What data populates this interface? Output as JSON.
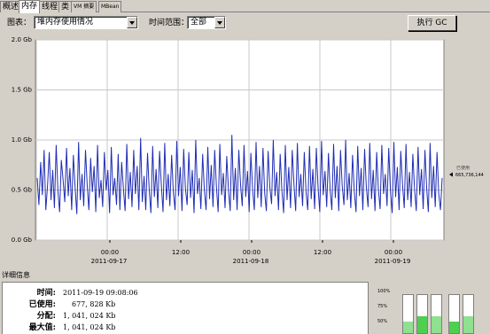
{
  "tabs": [
    {
      "label": "概述",
      "active": false
    },
    {
      "label": "内存",
      "active": true
    },
    {
      "label": "线程",
      "active": false
    },
    {
      "label": "类",
      "active": false
    },
    {
      "label": "VM 摘要",
      "active": false
    },
    {
      "label": "MBean",
      "active": false
    }
  ],
  "toolbar": {
    "chart_label": "图表：",
    "chart_value": "堆内存使用情况",
    "time_label": "时间范围：",
    "time_value": "全部",
    "gc_button": "执行 GC"
  },
  "chart_data": {
    "type": "line",
    "y_ticks": [
      "2.0 Gb",
      "1.5 Gb",
      "1.0 Gb",
      "0.5 Gb",
      "0.0 Gb"
    ],
    "ylim": [
      0,
      2.0
    ],
    "x_ticks": [
      {
        "time": "00:00",
        "date": "2011-09-17"
      },
      {
        "time": "12:00",
        "date": ""
      },
      {
        "time": "00:00",
        "date": "2011-09-18"
      },
      {
        "time": "12:00",
        "date": ""
      },
      {
        "time": "00:00",
        "date": "2011-09-19"
      }
    ],
    "legend_label": "已使用",
    "legend_value": "665,736,144",
    "series_color": "#1f2db4",
    "series": [
      {
        "values": [
          0.62,
          0.35,
          0.78,
          0.45,
          0.9,
          0.3,
          0.55,
          0.88,
          0.4,
          0.7,
          0.32,
          0.95,
          0.5,
          0.28,
          0.8,
          0.6,
          0.38,
          0.92,
          0.44,
          0.72,
          0.3,
          0.85,
          0.52,
          0.26,
          0.98,
          0.4,
          0.66,
          0.34,
          0.9,
          0.55,
          0.3,
          0.82,
          0.48,
          0.74,
          0.28,
          0.95,
          0.42,
          0.6,
          0.33,
          0.88,
          0.5,
          0.7,
          0.27,
          0.93,
          0.45,
          0.62,
          0.35,
          0.86,
          0.3,
          0.78,
          0.52,
          0.29,
          0.96,
          0.41,
          0.68,
          0.33,
          0.9,
          0.46,
          0.74,
          0.3,
          1.02,
          0.38,
          0.64,
          0.3,
          0.87,
          0.5,
          0.27,
          0.94,
          0.43,
          0.71,
          0.32,
          0.89,
          0.56,
          0.28,
          0.97,
          0.4,
          0.66,
          0.34,
          0.85,
          0.48,
          0.3,
          0.99,
          0.44,
          0.73,
          0.29,
          0.91,
          0.52,
          0.35,
          0.88,
          0.42,
          0.7,
          0.27,
          1.0,
          0.46,
          0.62,
          0.31,
          0.86,
          0.5,
          0.3,
          0.93,
          0.41,
          0.75,
          0.33,
          0.9,
          0.54,
          0.28,
          0.96,
          0.45,
          0.67,
          0.32,
          0.84,
          0.49,
          0.29,
          1.05,
          0.4,
          0.72,
          0.3,
          0.9,
          0.55,
          0.34,
          0.95,
          0.43,
          0.69,
          0.28,
          0.87,
          0.51,
          0.3,
          0.98,
          0.42,
          0.74,
          0.33,
          0.92,
          0.47,
          0.29,
          0.89,
          0.53,
          0.36,
          1.0,
          0.44,
          0.68,
          0.3,
          0.86,
          0.5,
          0.27,
          0.95,
          0.4,
          0.73,
          0.32,
          0.9,
          0.55,
          0.29,
          0.97,
          0.43,
          0.66,
          0.34,
          0.88,
          0.48,
          0.3,
          0.94,
          0.41,
          0.71,
          0.31,
          0.92,
          0.52,
          0.28,
          0.99,
          0.45,
          0.69,
          0.33,
          0.87,
          0.5,
          0.3,
          0.96,
          0.42,
          0.74,
          0.29,
          0.9,
          0.54,
          0.35,
          1.0,
          0.4,
          0.67,
          0.32,
          0.85,
          0.49,
          0.28,
          0.94,
          0.44,
          0.72,
          0.3,
          0.91,
          0.53,
          0.33,
          0.97,
          0.41,
          0.7,
          0.29,
          0.88,
          0.51,
          0.31,
          0.95,
          0.46,
          0.66,
          0.34,
          0.92,
          0.48,
          0.27,
          0.98,
          0.43,
          0.73,
          0.3,
          0.89,
          0.55,
          0.32,
          0.96,
          0.4,
          0.68,
          0.33,
          0.86,
          0.5,
          0.29,
          0.93,
          0.45,
          0.71,
          0.31,
          0.9,
          0.52,
          0.28,
          0.97,
          0.42,
          0.74,
          0.33,
          0.88,
          0.47,
          0.3,
          0.62
        ]
      }
    ]
  },
  "details": {
    "title": "详细信息",
    "rows": [
      {
        "key": "时间:",
        "value": "2011-09-19 09:08:06"
      },
      {
        "key": "已使用:",
        "value": "677, 828 Kb"
      },
      {
        "key": "分配:",
        "value": "1, 041, 024 Kb"
      },
      {
        "key": "最大值:",
        "value": "1, 041, 024 Kb"
      }
    ]
  },
  "meters": {
    "labels": [
      "100%",
      "75%",
      "50%"
    ],
    "levels": [
      0.3,
      0.45,
      0.45,
      0.3,
      0.45
    ]
  }
}
